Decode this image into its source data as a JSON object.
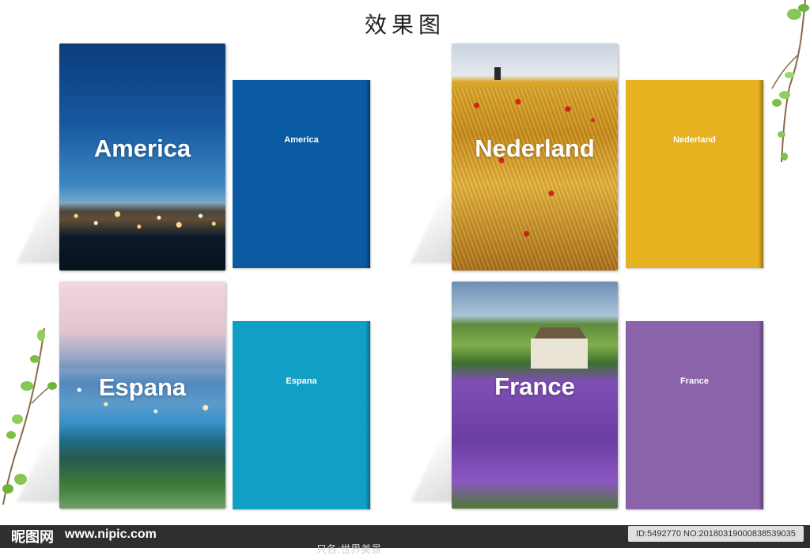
{
  "page": {
    "title": "效果图"
  },
  "books": [
    {
      "id": "america",
      "cover_label": "America",
      "back_label": "America",
      "back_color": "#0a5aa2"
    },
    {
      "id": "nederland",
      "cover_label": "Nederland",
      "back_label": "Nederland",
      "back_color": "#e6b21f"
    },
    {
      "id": "espana",
      "cover_label": "Espana",
      "back_label": "Espana",
      "back_color": "#129fc5"
    },
    {
      "id": "france",
      "cover_label": "France",
      "back_label": "France",
      "back_color": "#8a63ab"
    }
  ],
  "footer": {
    "logo": "昵图网",
    "url": "www.nipic.com",
    "id_text": "ID:5492770 NO:20180319000838539035",
    "sub_text": "只各:世界美景"
  }
}
